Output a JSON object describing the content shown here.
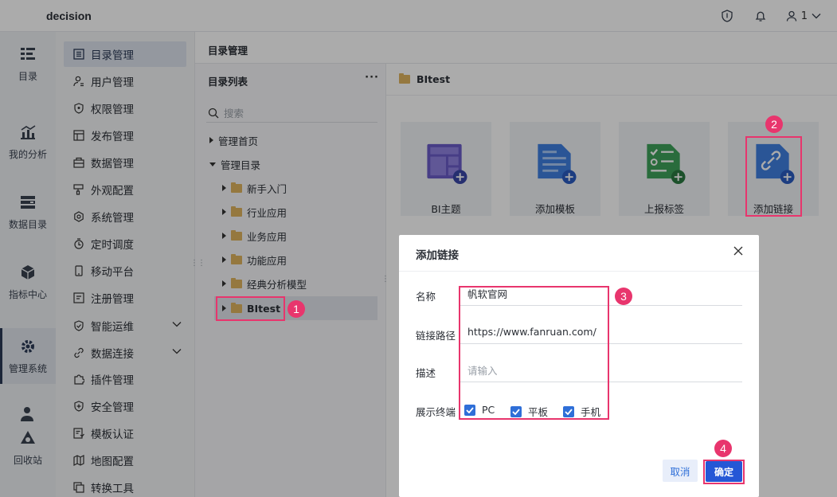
{
  "app": {
    "brand": "decision",
    "user": "1"
  },
  "rail": {
    "items": [
      {
        "label": "目录",
        "icon": "catalog-icon"
      },
      {
        "label": "我的分析",
        "icon": "analysis-icon"
      },
      {
        "label": "数据目录",
        "icon": "data-catalog-icon"
      },
      {
        "label": "指标中心",
        "icon": "metrics-icon"
      },
      {
        "label": "管理系统",
        "icon": "gear-icon",
        "active": true
      },
      {
        "label": "回收站",
        "icon": "recycle-icon"
      }
    ]
  },
  "menu": {
    "items": [
      {
        "label": "目录管理",
        "icon": "catalog-icon"
      },
      {
        "label": "用户管理",
        "icon": "user-icon"
      },
      {
        "label": "权限管理",
        "icon": "shield-icon"
      },
      {
        "label": "发布管理",
        "icon": "publish-icon"
      },
      {
        "label": "数据管理",
        "icon": "database-icon"
      },
      {
        "label": "外观配置",
        "icon": "brush-icon"
      },
      {
        "label": "系统管理",
        "icon": "settings-icon"
      },
      {
        "label": "定时调度",
        "icon": "timer-icon"
      },
      {
        "label": "移动平台",
        "icon": "mobile-icon"
      },
      {
        "label": "注册管理",
        "icon": "register-icon"
      },
      {
        "label": "智能运维",
        "icon": "ops-icon"
      },
      {
        "label": "数据连接",
        "icon": "link-icon"
      },
      {
        "label": "插件管理",
        "icon": "plugin-icon"
      },
      {
        "label": "安全管理",
        "icon": "security-icon"
      },
      {
        "label": "模板认证",
        "icon": "template-auth-icon"
      },
      {
        "label": "地图配置",
        "icon": "map-icon"
      },
      {
        "label": "转换工具",
        "icon": "convert-icon"
      }
    ]
  },
  "breadcrumb": "目录管理",
  "tree": {
    "title": "目录列表",
    "more": "···",
    "search_placeholder": "搜索",
    "nodes": [
      "管理首页",
      "管理目录",
      "新手入门",
      "行业应用",
      "业务应用",
      "功能应用",
      "经典分析模型",
      "BItest"
    ]
  },
  "content": {
    "folder": "BItest",
    "cards": [
      "BI主题",
      "添加模板",
      "上报标签",
      "添加链接"
    ]
  },
  "dialog": {
    "title": "添加链接",
    "name_label": "名称",
    "name_value": "帆软官网",
    "path_label": "链接路径",
    "path_value": "https://www.fanruan.com/",
    "desc_label": "描述",
    "desc_placeholder": "请输入",
    "terminal_label": "展示终端",
    "terminals": [
      "PC",
      "平板",
      "手机"
    ],
    "cancel": "取消",
    "ok": "确定"
  },
  "annotations": [
    "1",
    "2",
    "3",
    "4"
  ],
  "colors": {
    "accent": "#2557d6",
    "highlight": "#e8356d",
    "folder": "#dfb35e"
  }
}
